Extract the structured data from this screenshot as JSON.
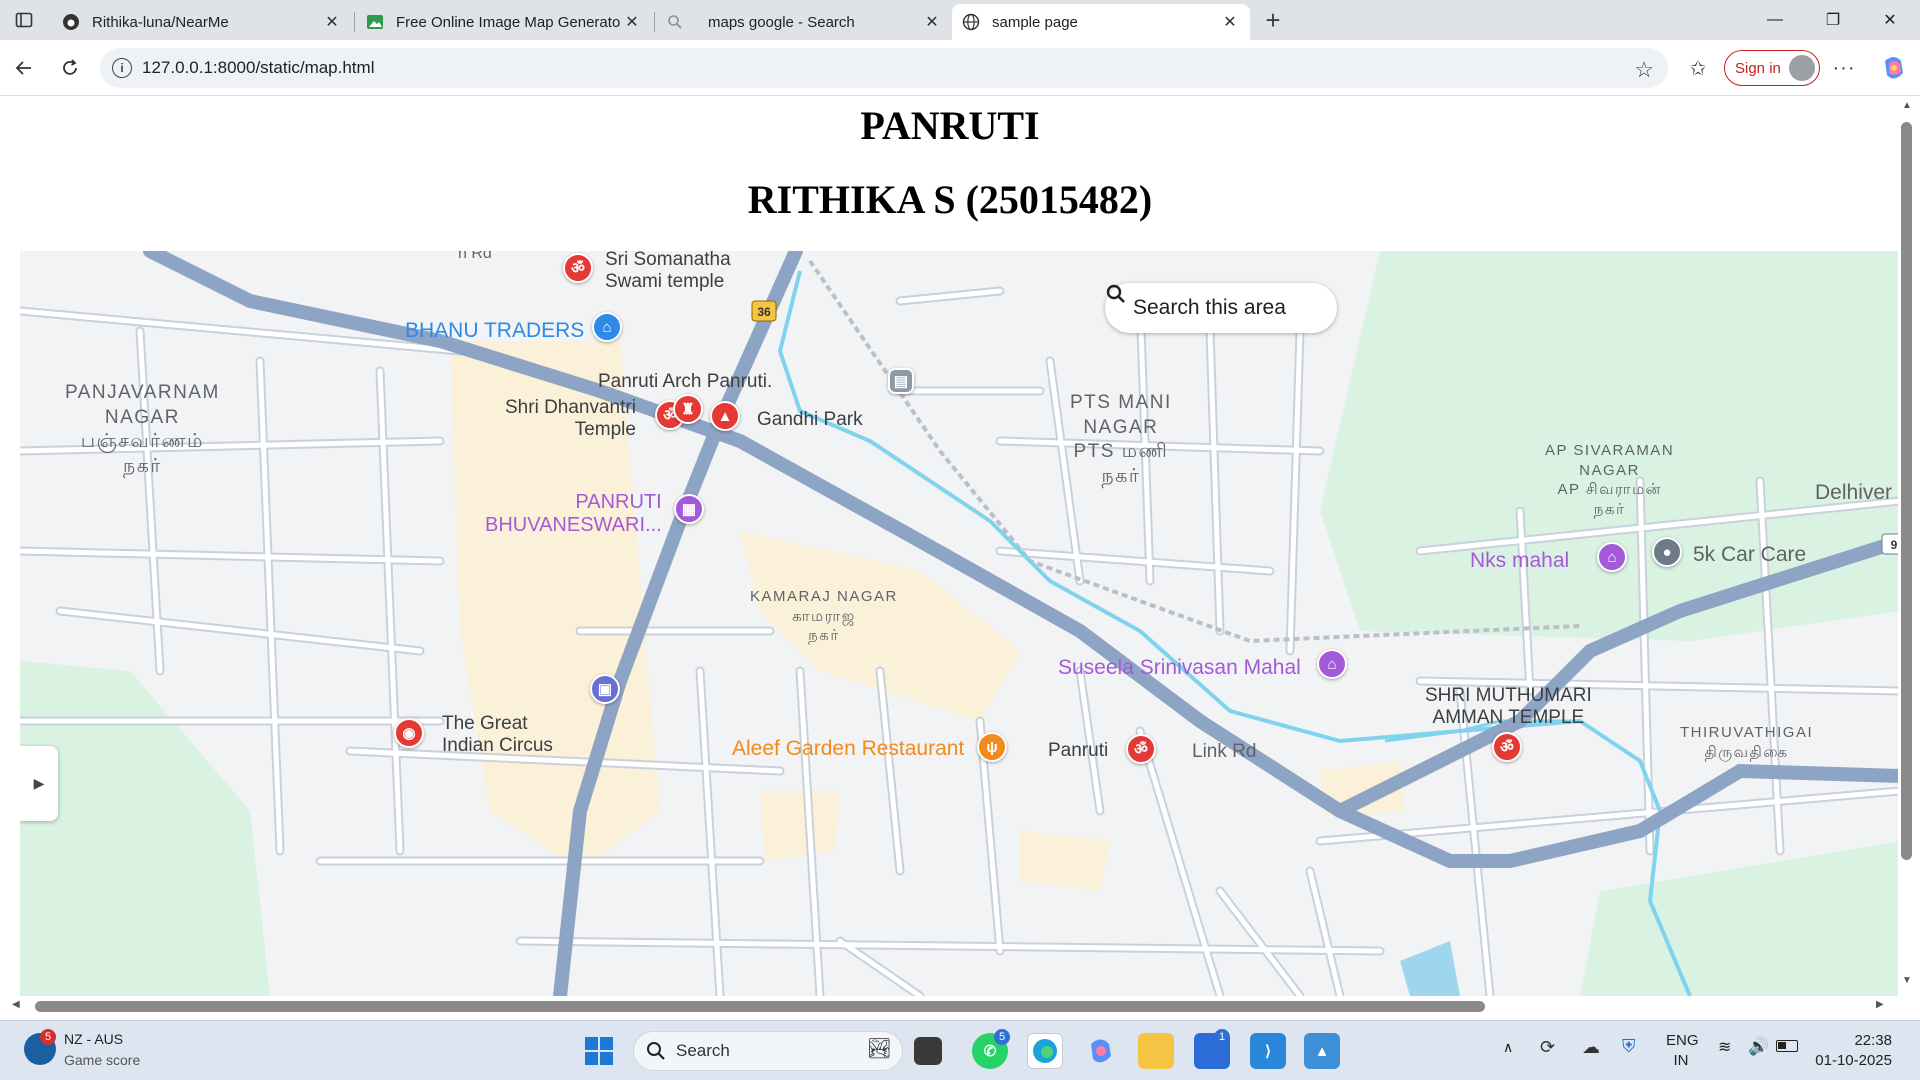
{
  "browser": {
    "tabs": [
      {
        "title": "Rithika-luna/NearMe",
        "icon": "github-icon"
      },
      {
        "title": "Free Online Image Map Generato",
        "icon": "image-icon"
      },
      {
        "title": "maps google - Search",
        "icon": "search-icon"
      },
      {
        "title": "sample page",
        "icon": "globe-icon",
        "active": true
      }
    ],
    "new_tab": "+",
    "url": "127.0.0.1:8000/static/map.html",
    "signin_label": "Sign in"
  },
  "page": {
    "title": "PANRUTI",
    "subtitle": "RITHIKA S (25015482)"
  },
  "map": {
    "search_area": "Search this area",
    "route_badge_36": "36",
    "route_badge_9": "9",
    "places": {
      "somanatha": "Sri Somanatha\nSwami temple",
      "bhanu": "BHANU TRADERS",
      "arch": "Panruti Arch Panruti.",
      "dhanvantri": "Shri Dhanvantri\nTemple",
      "gandhi": "Gandhi Park",
      "bhuvaneswari": "PANRUTI\nBHUVANESWARI...",
      "circus": "The Great\nIndian Circus",
      "aleef": "Aleef Garden Restaurant",
      "panruti": "Panruti",
      "linkrd": "Link Rd",
      "suseela": "Suseela Srinivasan Mahal",
      "nks": "Nks mahal",
      "carcare": "5k Car Care",
      "delhiver": "Delhiver",
      "muthumari": "SHRI MUTHUMARI\nAMMAN TEMPLE",
      "rd": "n Rd"
    },
    "areas": {
      "panjavarnam": "PANJAVARNAM\nNAGAR\nபஞ்சவர்ணம்\nநகர்",
      "ptsmani": "PTS MANI\nNAGAR\nPTS மணி\nநகர்",
      "kamaraj": "KAMARAJ NAGAR\nகாமராஜ\nநகர்",
      "sivaraman": "AP SIVARAMAN\nNAGAR\nAP சிவராமன்\nநகர்",
      "thiruvathigai": "THIRUVATHIGAI\nதிருவதிகை"
    }
  },
  "taskbar": {
    "score_title": "NZ - AUS",
    "score_sub": "Game score",
    "score_badge": "5",
    "search_label": "Search",
    "whatsapp_badge": "5",
    "store_badge": "1",
    "lang_top": "ENG",
    "lang_bottom": "IN",
    "time": "22:38",
    "date": "01-10-2025"
  },
  "colors": {
    "major_road": "#8ea4c4",
    "minor_road": "#ffffff",
    "water": "#7fd3ee",
    "park": "#d9f2e2",
    "commercial": "#fbf1d8",
    "temple_pin": "#e53935",
    "shop_pin": "#2e89e8",
    "venue_pin": "#a45ad8",
    "food_pin": "#f28a1d"
  }
}
